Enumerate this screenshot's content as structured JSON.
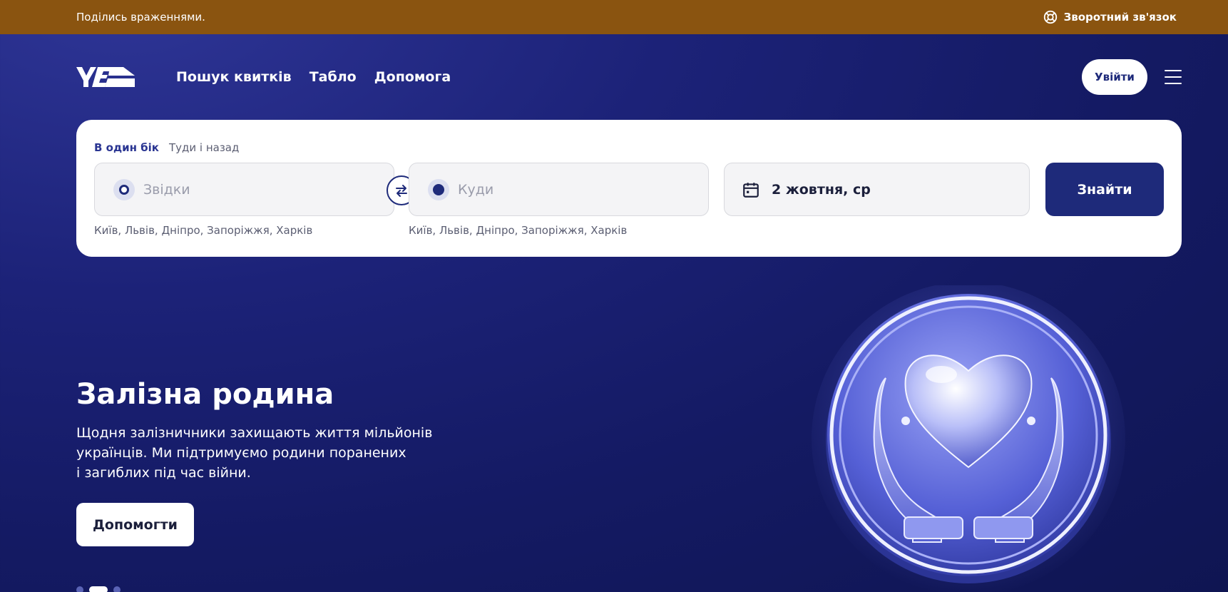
{
  "topbar": {
    "message": "Поділись враженнями.",
    "feedback_label": "Зворотний зв'язок",
    "feedback_icon": "lifebuoy-icon"
  },
  "header": {
    "logo_text": "УЗ",
    "nav": [
      "Пошук квитків",
      "Табло",
      "Допомога"
    ],
    "login_label": "Увійти",
    "menu_icon": "hamburger-icon"
  },
  "search": {
    "tabs": [
      {
        "label": "В один бік",
        "active": true
      },
      {
        "label": "Туди і назад",
        "active": false
      }
    ],
    "from_placeholder": "Звідки",
    "to_placeholder": "Куди",
    "date_value": "2 жовтня, ср",
    "find_label": "Знайти",
    "from_hint": "Київ, Львів, Дніпро, Запоріжжя, Харків",
    "to_hint": "Київ, Львів, Дніпро, Запоріжжя, Харків"
  },
  "hero": {
    "title": "Залізна родина",
    "text_lines": [
      "Щодня залізничники захищають життя мільйонів",
      "українців. Ми підтримуємо родини поранених",
      "і загиблих під час війни."
    ],
    "button_label": "Допомогти",
    "slides_count": 3,
    "active_slide": 2
  },
  "colors": {
    "topbar": "#8a5410",
    "brand": "#1e2a7a",
    "background": "#141a63"
  }
}
